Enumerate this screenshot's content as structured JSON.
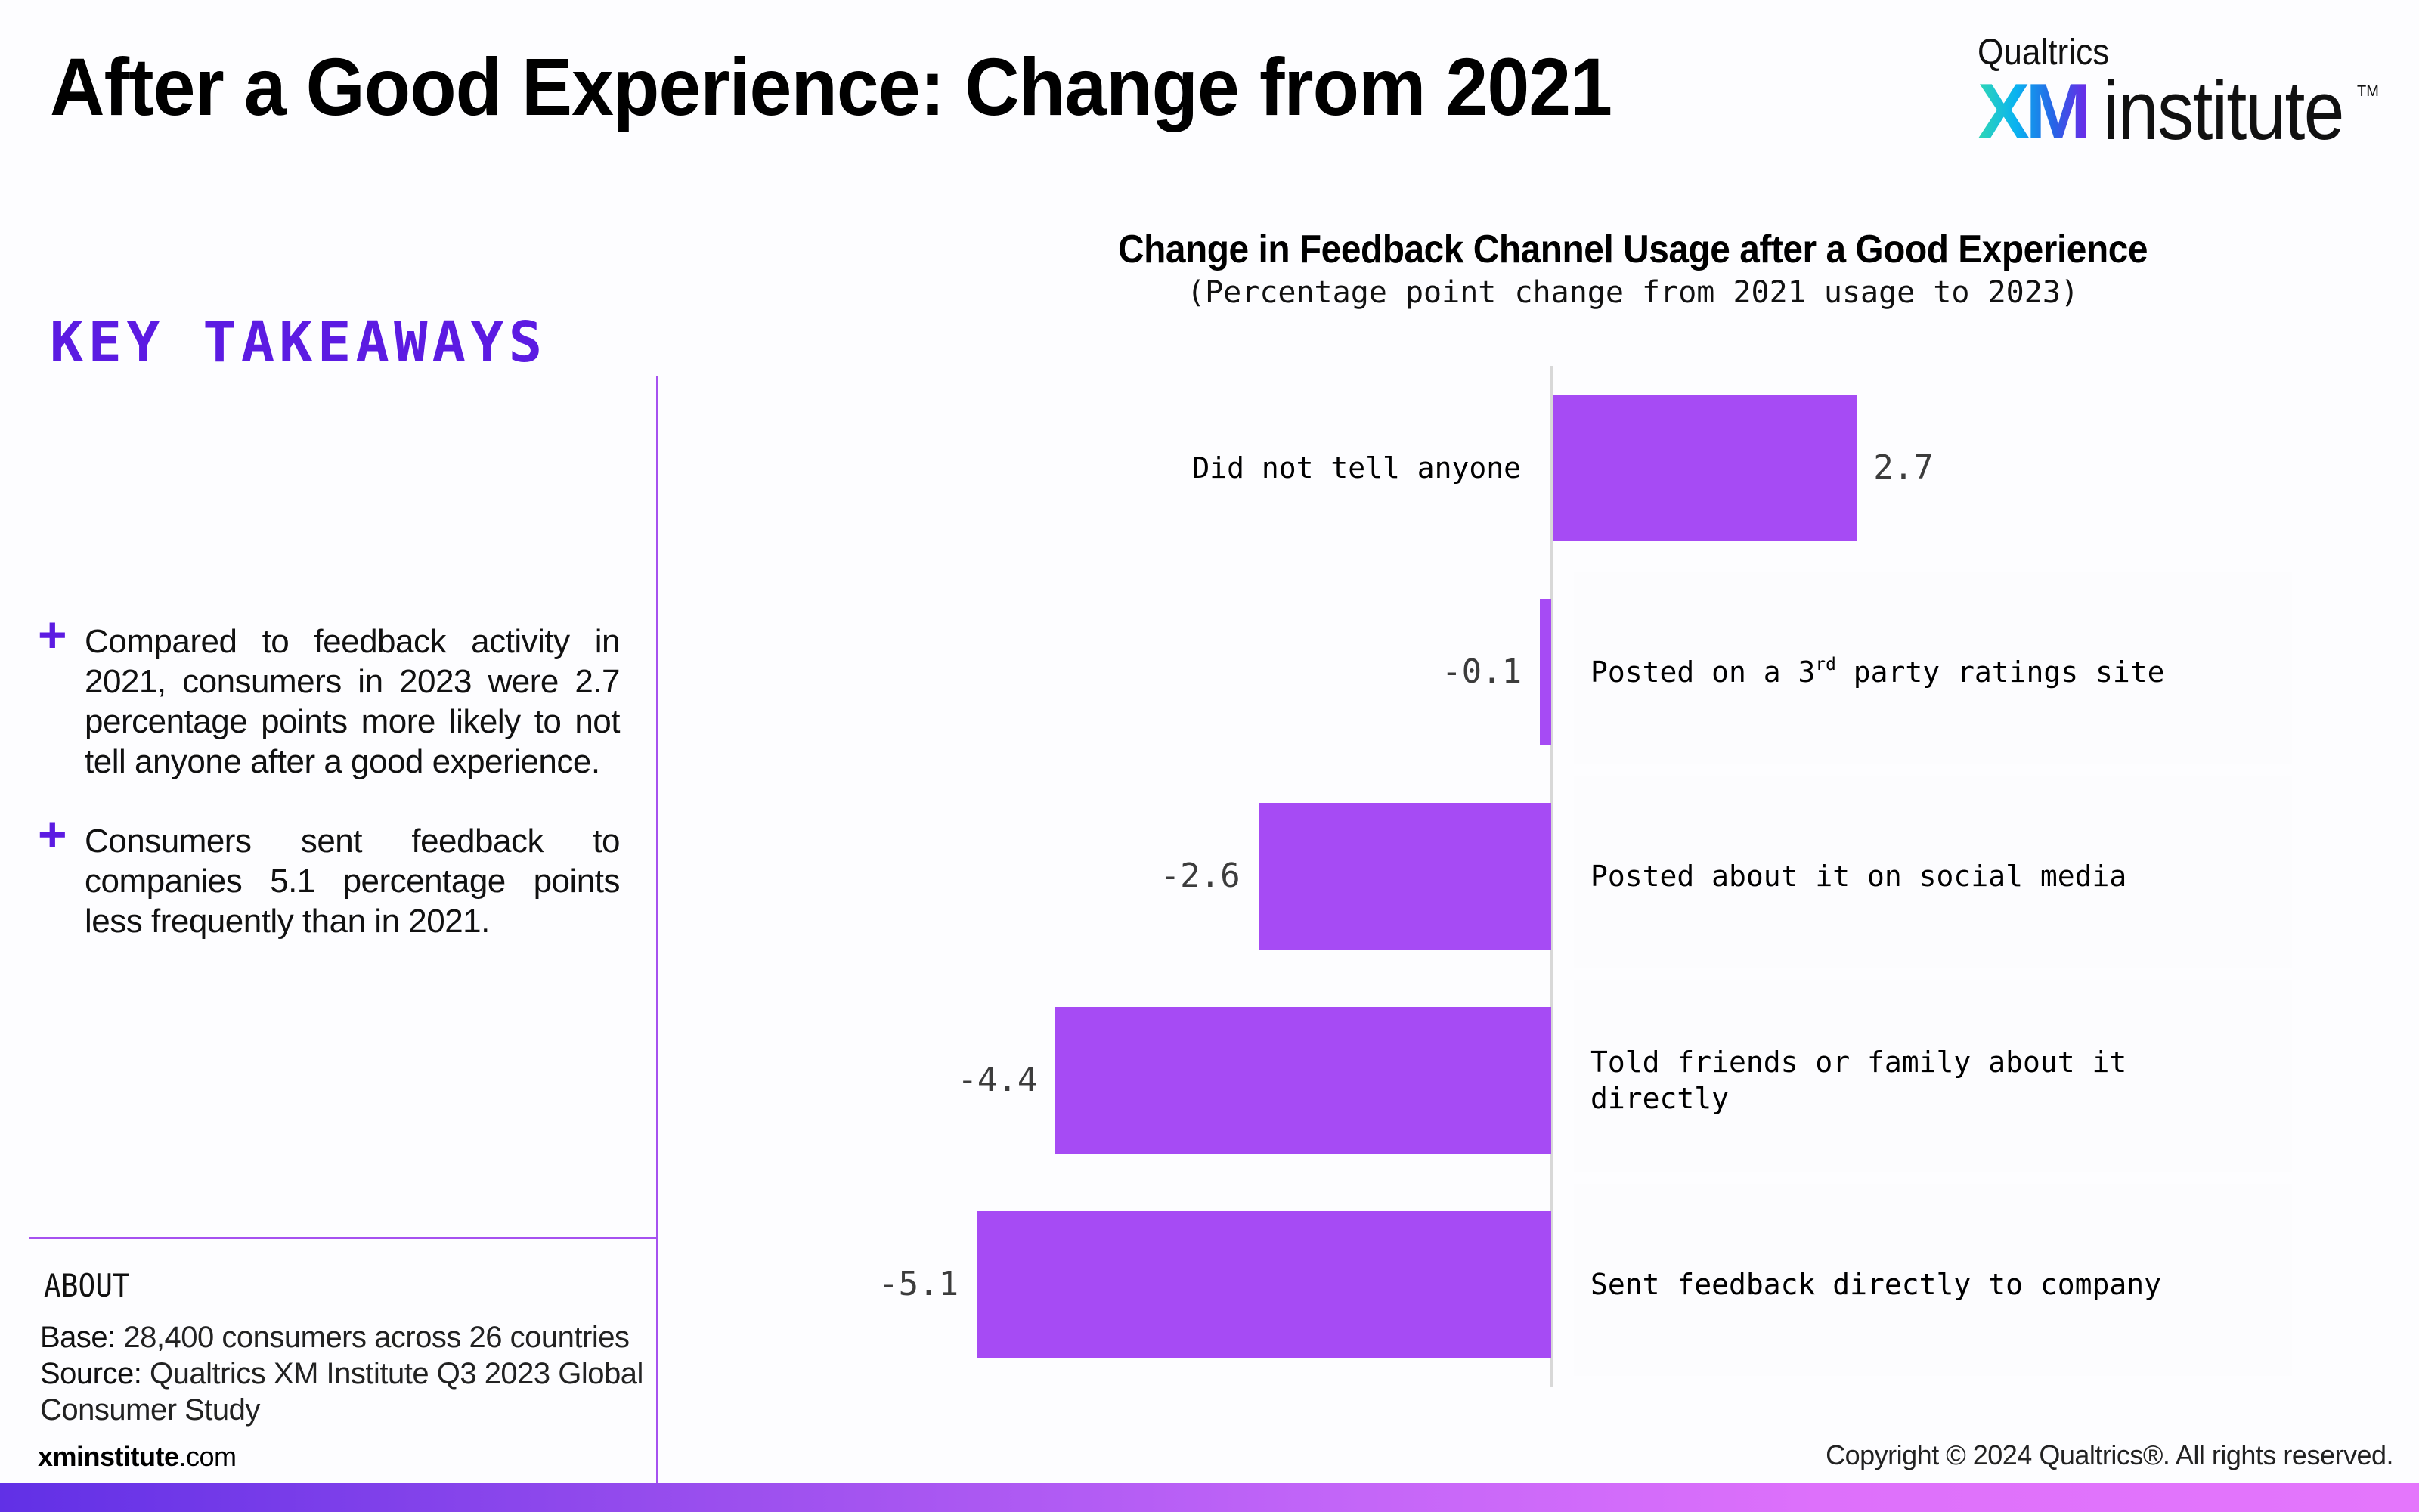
{
  "header": {
    "title": "After a Good Experience: Change from 2021",
    "logo": {
      "top": "Qualtrics",
      "xm": "XM",
      "institute": "institute",
      "tm": "TM"
    }
  },
  "sidebar": {
    "heading": "KEY TAKEAWAYS",
    "takeaways": [
      {
        "icon": "plus-icon",
        "text": "Compared to feedback activity in 2021, consumers in 2023 were 2.7 percentage points more likely to not tell anyone after a good experience."
      },
      {
        "icon": "plus-icon",
        "text": "Consumers sent feedback to companies 5.1 percentage points less frequently than in 2021."
      }
    ],
    "about": {
      "heading": "ABOUT",
      "base_label": "Base:",
      "base_value": "28,400 consumers across 26 countries",
      "source_label": "Source:",
      "source_value": "Qualtrics XM Institute Q3 2023 Global Consumer Study"
    },
    "site": {
      "bold": "xminstitute",
      "rest": ".com"
    }
  },
  "footer": {
    "copyright": "Copyright © 2024 Qualtrics®. All rights reserved."
  },
  "colors": {
    "bar": "#a64bf4",
    "accent": "#5c1be2",
    "divider": "#a652f0"
  },
  "chart_data": {
    "type": "bar",
    "orientation": "horizontal",
    "title": "Change in Feedback Channel Usage after a Good Experience",
    "subtitle": "(Percentage point change from 2021 usage to 2023)",
    "xlabel": "",
    "ylabel": "",
    "grid": false,
    "categories": [
      "Did not tell anyone",
      "Posted on a 3rd party ratings site",
      "Posted about it on social media",
      "Told friends or family about it directly",
      "Sent feedback directly to company"
    ],
    "category_display": [
      {
        "pre": "Did not tell anyone",
        "sup": "",
        "post": ""
      },
      {
        "pre": "Posted on a 3",
        "sup": "rd",
        "post": " party ratings site"
      },
      {
        "pre": "Posted about it on social media",
        "sup": "",
        "post": ""
      },
      {
        "pre": "Told friends or family about it\ndirectly",
        "sup": "",
        "post": ""
      },
      {
        "pre": "Sent feedback directly to company",
        "sup": "",
        "post": ""
      }
    ],
    "values": [
      2.7,
      -0.1,
      -2.6,
      -4.4,
      -5.1
    ],
    "value_labels": [
      "2.7",
      "-0.1",
      "-2.6",
      "-4.4",
      "-5.1"
    ],
    "xlim": [
      -5.5,
      3.0
    ]
  }
}
